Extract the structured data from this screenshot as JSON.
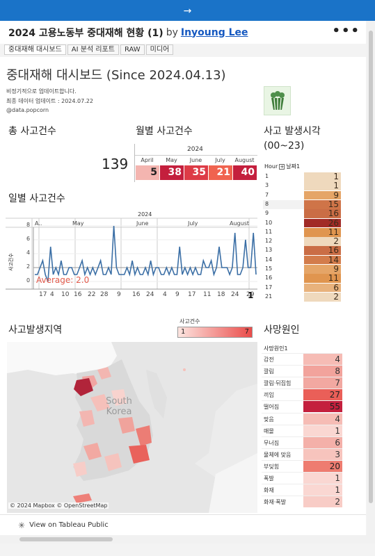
{
  "banner": {
    "arrow": "→"
  },
  "header": {
    "title": "2024 고용노동부 중대재해 현황 (1)",
    "by": "by",
    "author": "Inyoung Lee",
    "more": "•••"
  },
  "tabs": [
    "중대재해 대시보드",
    "AI 분석 리포트",
    "RAW",
    "미디어"
  ],
  "dashboard": {
    "title": "중대재해 대시보드 (Since 2024.04.13)",
    "notes": [
      "비정기적으로 업데이트합니다.",
      "최종 데이터 업데이트 : 2024.07.22",
      "@data.popcorn"
    ],
    "total": {
      "title": "총 사고건수",
      "value": "139"
    },
    "monthly": {
      "title": "월별 사고건수",
      "year": "2024",
      "months": [
        "April",
        "May",
        "June",
        "July",
        "August"
      ],
      "values": [
        5,
        38,
        35,
        21,
        40
      ],
      "colors": [
        "#f4b5b0",
        "#c41f3d",
        "#dd3b46",
        "#f0634f",
        "#c41f3d"
      ]
    },
    "hourly": {
      "title": "사고 발생시각",
      "subtitle": "(00~23)",
      "header_col1": "Hour",
      "header_col2": "날짜1",
      "hours": [
        "1",
        "3",
        "7",
        "8",
        "9",
        "10",
        "11",
        "12",
        "13",
        "14",
        "15",
        "16",
        "17",
        "21"
      ],
      "counts": [
        1,
        1,
        9,
        15,
        16,
        26,
        11,
        2,
        16,
        14,
        9,
        11,
        6,
        2
      ],
      "colors": [
        "#efd9bd",
        "#efd9bd",
        "#e5a567",
        "#cf7448",
        "#ca6d45",
        "#a12a26",
        "#e0954f",
        "#efd9bd",
        "#ca6d45",
        "#d37c4b",
        "#e5a567",
        "#e0954f",
        "#e8b27c",
        "#efd9bd"
      ]
    },
    "daily": {
      "title": "일별 사고건수",
      "year": "2024",
      "months": [
        "A..",
        "May",
        "June",
        "July",
        "August"
      ],
      "y_label": "사고건수",
      "y_ticks": [
        "8",
        "6",
        "4",
        "2",
        "0"
      ],
      "x_ticks": [
        "17",
        "4",
        "10",
        "16",
        "22",
        "28",
        "9",
        "16",
        "24",
        "4",
        "9",
        "17",
        "11",
        "18",
        "24",
        "29"
      ],
      "average_label": "Average: 2.0",
      "last_label": "1"
    },
    "map": {
      "title": "사고발생지역",
      "legend_title": "사고건수",
      "legend_min": "1",
      "legend_max": "7",
      "label": "South Korea",
      "credit": "© 2024 Mapbox  © OpenStreetMap"
    },
    "causes": {
      "title": "사망원인",
      "header": "사망원인1",
      "names": [
        "감전",
        "깔림",
        "깔림·뒤집힘",
        "끼임",
        "떨어짐",
        "맞음",
        "매몰",
        "무너짐",
        "물체에 맞음",
        "부딪힘",
        "폭발",
        "화재",
        "화재·폭발"
      ],
      "counts": [
        4,
        8,
        7,
        27,
        55,
        4,
        1,
        6,
        3,
        20,
        1,
        1,
        2
      ],
      "colors": [
        "#f6bcb5",
        "#f2a39c",
        "#f2a8a1",
        "#ea5f58",
        "#c41f3d",
        "#f6bcb5",
        "#fad7d2",
        "#f4b0a9",
        "#f7c4bd",
        "#ee7c70",
        "#fad7d2",
        "#fad7d2",
        "#f8ccc6"
      ],
      "text_colors": [
        "#333",
        "#333",
        "#333",
        "#222",
        "#222",
        "#333",
        "#333",
        "#333",
        "#333",
        "#222",
        "#333",
        "#333",
        "#333"
      ]
    }
  },
  "footer": {
    "view_label": "View on Tableau Public"
  },
  "colors": {
    "accent": "#1a73c8",
    "link": "#1558c0"
  }
}
